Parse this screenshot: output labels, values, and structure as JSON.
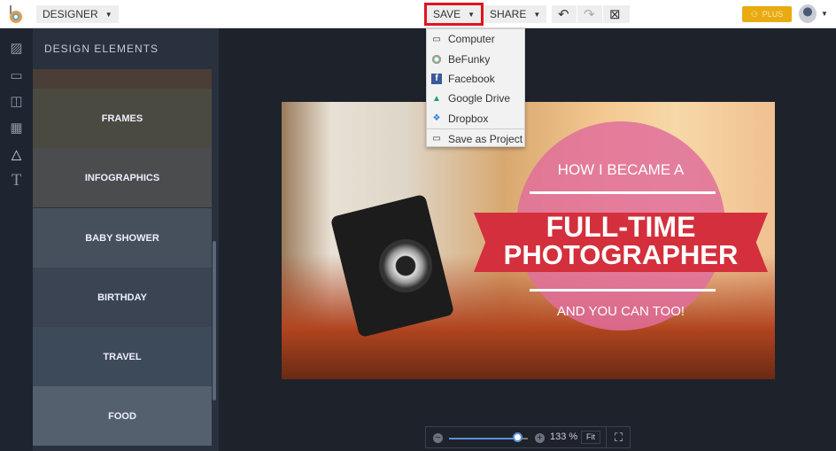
{
  "topbar": {
    "mode": "DESIGNER",
    "save": "SAVE",
    "share": "SHARE",
    "undo": "↶",
    "redo": "↷",
    "close": "⊠",
    "plus": "PLUS"
  },
  "sidebar": {
    "title": "DESIGN ELEMENTS",
    "rail_icons": [
      "image-icon",
      "folder-icon",
      "layout-icon",
      "grid-icon",
      "shapes-icon",
      "text-icon"
    ],
    "tiles": [
      {
        "label": "FRAMES",
        "color": "#4a4a40"
      },
      {
        "label": "INFOGRAPHICS",
        "color": "#4b4c4d"
      },
      {
        "label": "BABY SHOWER",
        "color": "#46505c"
      },
      {
        "label": "BIRTHDAY",
        "color": "#3a4452"
      },
      {
        "label": "TRAVEL",
        "color": "#3d4a5a"
      },
      {
        "label": "FOOD",
        "color": "#55606e"
      }
    ]
  },
  "save_menu": {
    "items": [
      {
        "label": "Computer",
        "icon": "monitor-icon"
      },
      {
        "label": "BeFunky",
        "icon": "befunky-icon"
      },
      {
        "label": "Facebook",
        "icon": "facebook-icon"
      },
      {
        "label": "Google Drive",
        "icon": "google-drive-icon"
      },
      {
        "label": "Dropbox",
        "icon": "dropbox-icon"
      },
      {
        "label": "Save as Project",
        "icon": "folder-icon"
      }
    ]
  },
  "design": {
    "line1": "HOW I BECAME A",
    "line2": "FULL-TIME",
    "line3": "PHOTOGRAPHER",
    "line4": "AND YOU CAN TOO!"
  },
  "zoom": {
    "value": "133 %",
    "fit": "Fit",
    "slider_fraction": 0.85
  }
}
